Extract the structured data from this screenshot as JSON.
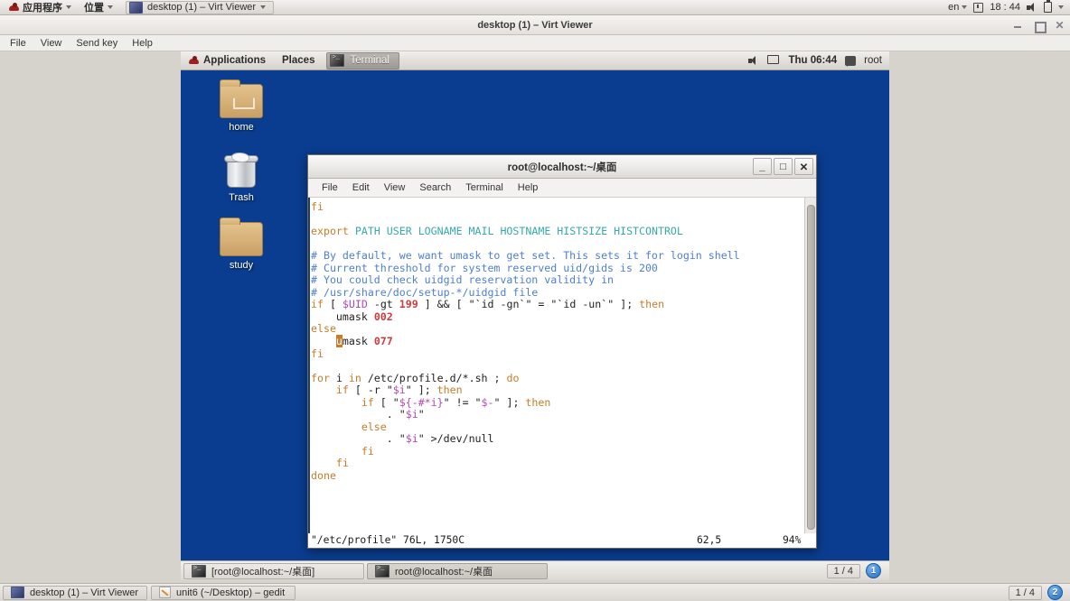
{
  "host_top_panel": {
    "applications_label": "应用程序",
    "places_label": "位置",
    "active_window_label": "desktop (1) – Virt Viewer",
    "keyboard_layout": "en",
    "clock": "18 : 44",
    "icons": {
      "redhat": "redhat-logo-icon",
      "clock": "clock-icon",
      "volume": "volume-icon",
      "battery": "battery-icon"
    }
  },
  "virt_viewer": {
    "title": "desktop (1) – Virt Viewer",
    "menu": [
      "File",
      "View",
      "Send key",
      "Help"
    ],
    "window_controls": [
      "minimize",
      "maximize",
      "close"
    ]
  },
  "vm": {
    "top_panel": {
      "applications_label": "Applications",
      "places_label": "Places",
      "active_task_label": "Terminal",
      "clock": "Thu 06:44",
      "user": "root"
    },
    "desktop_icons": [
      {
        "label": "home",
        "type": "folder-home"
      },
      {
        "label": "Trash",
        "type": "trash"
      },
      {
        "label": "study",
        "type": "folder"
      }
    ],
    "terminal": {
      "title": "root@localhost:~/桌面",
      "menu": [
        "File",
        "Edit",
        "View",
        "Search",
        "Terminal",
        "Help"
      ],
      "window_controls": [
        "_",
        "□",
        "✕"
      ],
      "status": {
        "file": "\"/etc/profile\" 76L, 1750C",
        "position": "62,5",
        "percent": "94%"
      },
      "lines": [
        "fi",
        "",
        "export PATH USER LOGNAME MAIL HOSTNAME HISTSIZE HISTCONTROL",
        "",
        "# By default, we want umask to get set. This sets it for login shell",
        "# Current threshold for system reserved uid/gids is 200",
        "# You could check uidgid reservation validity in",
        "# /usr/share/doc/setup-*/uidgid file",
        "if [ $UID -gt 199 ] && [ \"`id -gn`\" = \"`id -un`\" ]; then",
        "    umask 002",
        "else",
        "    umask 077",
        "fi",
        "",
        "for i in /etc/profile.d/*.sh ; do",
        "    if [ -r \"$i\" ]; then",
        "        if [ \"${-#*i}\" != \"$-\" ]; then",
        "            . \"$i\"",
        "        else",
        "            . \"$i\" >/dev/null",
        "        fi",
        "    fi",
        "done"
      ]
    },
    "taskbar": {
      "tasks": [
        {
          "label": "[root@localhost:~/桌面]",
          "active": false
        },
        {
          "label": "root@localhost:~/桌面",
          "active": true
        }
      ],
      "workspace_label": "1 / 4",
      "workspace_badge": "1"
    }
  },
  "host_taskbar": {
    "tasks": [
      {
        "label": "desktop (1) – Virt Viewer",
        "icon": "monitor-icon"
      },
      {
        "label": "unit6 (~/Desktop) – gedit",
        "icon": "gedit-icon"
      }
    ],
    "workspace_label": "1 / 4",
    "workspace_badge": "2"
  },
  "colors": {
    "desktop_blue": "#0a3d8f",
    "keyword_orange": "#c87c28",
    "identifier_teal": "#3aa8a8",
    "comment_blue": "#4e7fd0",
    "number_red": "#d03a3a",
    "variable_magenta": "#b04ab0"
  }
}
